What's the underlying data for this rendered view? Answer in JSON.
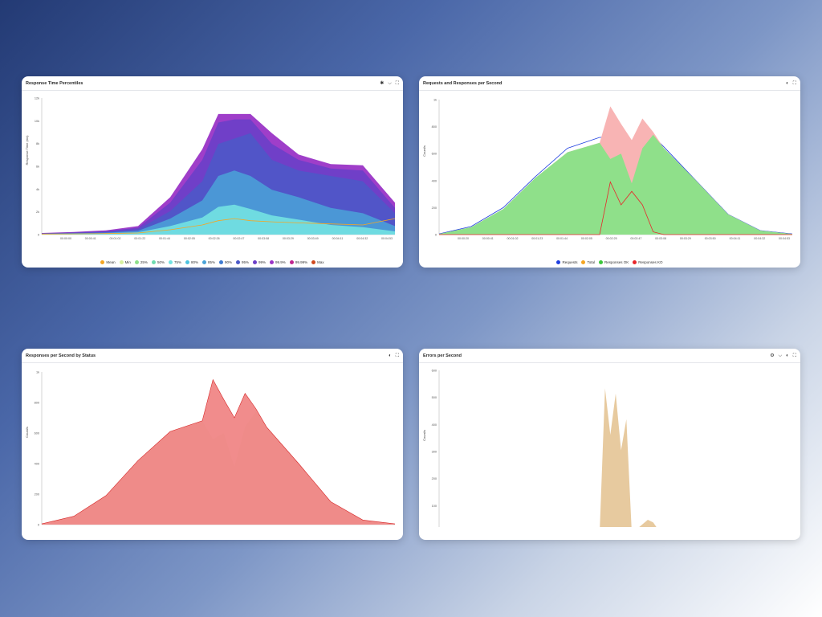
{
  "panels": [
    {
      "title": "Response Time Percentiles",
      "tools": [
        {
          "name": "settings-icon",
          "glyph": "✱"
        },
        {
          "name": "chevron-down-icon",
          "glyph": "⌵"
        },
        {
          "name": "fullscreen-icon",
          "glyph": "⛶"
        }
      ],
      "legend": [
        {
          "label": "Mean",
          "color": "#f5a623"
        },
        {
          "label": "Min",
          "color": "#d7f0a0"
        },
        {
          "label": "25%",
          "color": "#8fe08a"
        },
        {
          "label": "50%",
          "color": "#6fdbb0"
        },
        {
          "label": "75%",
          "color": "#73e2e2"
        },
        {
          "label": "80%",
          "color": "#4dc3e0"
        },
        {
          "label": "85%",
          "color": "#4aa3d8"
        },
        {
          "label": "90%",
          "color": "#3f7bd1"
        },
        {
          "label": "95%",
          "color": "#4b59c8"
        },
        {
          "label": "99%",
          "color": "#6a3fc8"
        },
        {
          "label": "99.9%",
          "color": "#9a34c6"
        },
        {
          "label": "99.99%",
          "color": "#c0268f"
        },
        {
          "label": "Max",
          "color": "#d04a1f"
        }
      ]
    },
    {
      "title": "Requests and Responses per Second",
      "tools": [
        {
          "name": "theme-toggle-icon",
          "glyph": "◐"
        },
        {
          "name": "fullscreen-icon",
          "glyph": "⛶"
        }
      ],
      "legend": [
        {
          "label": "Requests",
          "color": "#1f3fe0"
        },
        {
          "label": "Total",
          "color": "#f5a623"
        },
        {
          "label": "Responses OK",
          "color": "#3cc63c"
        },
        {
          "label": "Responses KO",
          "color": "#e8262b"
        }
      ]
    },
    {
      "title": "Responses per Second by Status",
      "tools": [
        {
          "name": "theme-toggle-icon",
          "glyph": "◐"
        },
        {
          "name": "fullscreen-icon",
          "glyph": "⛶"
        }
      ],
      "legend": []
    },
    {
      "title": "Errors per Second",
      "tools": [
        {
          "name": "settings-icon",
          "glyph": "⚙"
        },
        {
          "name": "chevron-down-icon",
          "glyph": "⌵"
        },
        {
          "name": "theme-toggle-icon",
          "glyph": "◐"
        },
        {
          "name": "fullscreen-icon",
          "glyph": "⛶"
        }
      ],
      "legend": []
    }
  ],
  "chart_data": [
    {
      "type": "area",
      "title": "Response Time Percentiles",
      "ylabel": "Response Time (ms)",
      "xlabel": "",
      "ylim": [
        0,
        12800
      ],
      "yticks": [
        "0",
        "2k",
        "4k",
        "6k",
        "8k",
        "10k",
        "12k"
      ],
      "xticks": [
        "00:00:00",
        "00:00:41",
        "00:01:02",
        "00:01:22",
        "00:01:44",
        "00:02:05",
        "00:02:26",
        "00:02:47",
        "00:03:08",
        "00:03:29",
        "00:03:49",
        "00:04:11",
        "00:04:32",
        "00:04:53"
      ],
      "x_seconds": [
        0,
        30,
        60,
        90,
        120,
        150,
        165,
        180,
        195,
        215,
        240,
        270,
        300,
        330
      ],
      "series": [
        {
          "name": "Max",
          "values": [
            150,
            250,
            400,
            800,
            3500,
            8000,
            11300,
            11300,
            11300,
            9500,
            7500,
            6600,
            6500,
            3000
          ]
        },
        {
          "name": "99%",
          "values": [
            120,
            200,
            320,
            650,
            3000,
            7000,
            10500,
            10800,
            10800,
            8500,
            7000,
            6200,
            6000,
            2500
          ]
        },
        {
          "name": "90%",
          "values": [
            100,
            160,
            250,
            500,
            2200,
            5000,
            8500,
            9000,
            9500,
            7000,
            6000,
            5500,
            5000,
            2000
          ]
        },
        {
          "name": "75%",
          "values": [
            80,
            120,
            180,
            350,
            1500,
            3200,
            5500,
            6000,
            5500,
            4200,
            3500,
            2500,
            2000,
            800
          ]
        },
        {
          "name": "50%",
          "values": [
            60,
            90,
            130,
            220,
            800,
            1600,
            2600,
            2800,
            2400,
            1800,
            1400,
            900,
            700,
            300
          ]
        },
        {
          "name": "Mean",
          "values": [
            50,
            70,
            100,
            150,
            450,
            900,
            1300,
            1500,
            1300,
            1200,
            1100,
            1000,
            900,
            1500
          ]
        }
      ]
    },
    {
      "type": "area",
      "title": "Requests and Responses per Second",
      "ylabel": "Count/s",
      "xlabel": "",
      "ylim": [
        0,
        1000
      ],
      "yticks": [
        "0",
        "200",
        "400",
        "600",
        "800",
        "1k"
      ],
      "xticks": [
        "00:00:20",
        "00:00:41",
        "00:01:02",
        "00:01:23",
        "00:01:44",
        "00:02:05",
        "00:02:25",
        "00:02:47",
        "00:03:08",
        "00:03:29",
        "00:03:50",
        "00:04:11",
        "00:04:32",
        "00:04:53"
      ],
      "x_seconds": [
        0,
        30,
        60,
        90,
        120,
        150,
        160,
        170,
        180,
        190,
        200,
        210,
        240,
        270,
        300,
        330
      ],
      "series": [
        {
          "name": "Requests",
          "values": [
            5,
            60,
            200,
            430,
            640,
            720,
            720,
            700,
            690,
            710,
            730,
            650,
            400,
            150,
            30,
            5
          ]
        },
        {
          "name": "Total",
          "values": [
            5,
            55,
            190,
            420,
            610,
            680,
            950,
            820,
            700,
            860,
            760,
            640,
            400,
            150,
            30,
            5
          ]
        },
        {
          "name": "Responses OK",
          "values": [
            5,
            55,
            190,
            420,
            610,
            680,
            560,
            600,
            380,
            640,
            740,
            640,
            400,
            150,
            30,
            5
          ]
        },
        {
          "name": "Responses KO",
          "values": [
            0,
            0,
            0,
            0,
            0,
            0,
            390,
            220,
            320,
            220,
            20,
            0,
            0,
            0,
            0,
            0
          ]
        }
      ]
    },
    {
      "type": "area",
      "title": "Responses per Second by Status",
      "ylabel": "Count/s",
      "xlabel": "",
      "ylim": [
        0,
        1000
      ],
      "yticks": [
        "0",
        "200",
        "400",
        "600",
        "800",
        "1k"
      ],
      "xticks": [
        "00:00:20",
        "00:00:41",
        "00:01:02",
        "00:01:23",
        "00:01:44",
        "00:02:05",
        "00:02:26",
        "00:02:47",
        "00:03:08",
        "00:03:29",
        "00:03:50",
        "00:04:11",
        "00:04:32",
        "00:04:53"
      ],
      "x_seconds": [
        0,
        30,
        60,
        90,
        120,
        150,
        160,
        170,
        180,
        190,
        200,
        210,
        240,
        270,
        300,
        330
      ],
      "series": [
        {
          "name": "OK",
          "values": [
            5,
            55,
            190,
            420,
            610,
            680,
            560,
            600,
            380,
            640,
            740,
            640,
            400,
            150,
            30,
            5
          ]
        },
        {
          "name": "Error",
          "values": [
            5,
            55,
            190,
            420,
            610,
            680,
            950,
            820,
            700,
            860,
            760,
            640,
            400,
            150,
            30,
            5
          ]
        }
      ]
    },
    {
      "type": "area",
      "title": "Errors per Second",
      "ylabel": "Count/s",
      "xlabel": "",
      "ylim": [
        0,
        630
      ],
      "yticks": [
        "0",
        "100",
        "200",
        "300",
        "400",
        "500",
        "600"
      ],
      "xticks": [
        "00:00:20",
        "00:00:41",
        "00:01:02",
        "00:01:23",
        "00:01:44",
        "00:02:05",
        "00:02:26",
        "00:02:47",
        "00:03:08",
        "00:03:29",
        "00:03:50",
        "00:04:11",
        "00:04:32",
        "00:04:53"
      ],
      "x_seconds": [
        0,
        150,
        155,
        160,
        165,
        170,
        175,
        180,
        185,
        195,
        200,
        205,
        210,
        330
      ],
      "series": [
        {
          "name": "Errors",
          "values": [
            0,
            0,
            560,
            380,
            540,
            320,
            440,
            0,
            15,
            50,
            40,
            10,
            0,
            0
          ]
        }
      ]
    }
  ]
}
